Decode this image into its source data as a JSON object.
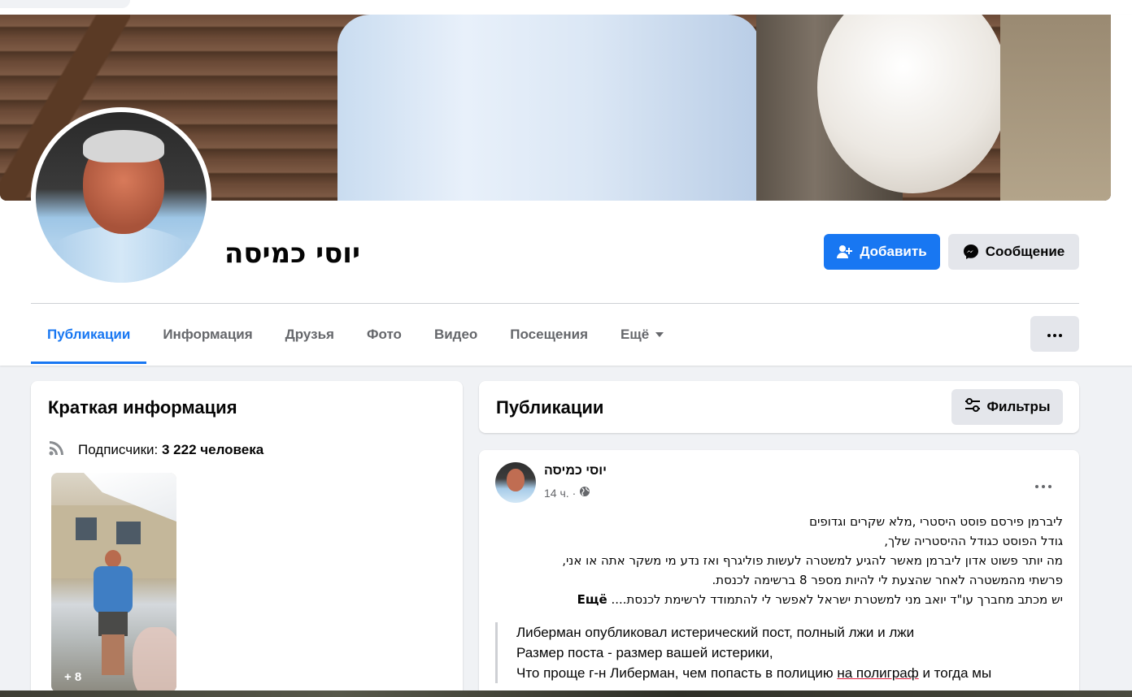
{
  "profile": {
    "name": "יוסי כמיסה",
    "add_label": "Добавить",
    "message_label": "Сообщение"
  },
  "tabs": [
    {
      "label": "Публикации",
      "active": true
    },
    {
      "label": "Информация"
    },
    {
      "label": "Друзья"
    },
    {
      "label": "Фото"
    },
    {
      "label": "Видео"
    },
    {
      "label": "Посещения"
    },
    {
      "label": "Ещё"
    }
  ],
  "intro": {
    "title": "Краткая информация",
    "followers_label": "Подписчики:",
    "followers_value": "3 222 человека",
    "photo_more": "+ 8"
  },
  "posts": {
    "title": "Публикации",
    "filters_label": "Фильтры"
  },
  "post": {
    "author": "יוסי כמיסה",
    "time": "14 ч.",
    "separator": "·",
    "lines": [
      "ליברמן פירסם פוסט היסטרי ,מלא שקרים וגדופים",
      "גודל הפוסט כגודל ההיסטריה שלך,",
      "מה יותר פשוט אדון ליברמן מאשר להגיע למשטרה לעשות  פוליגרף ואז נדע מי משקר אתה או אני,",
      "פרשתי מהמשטרה לאחר שהצעת לי להיות מספר 8 ברשימה לכנסת.",
      "יש מכתב מחברך  עו\"ד יואב מני למשטרת ישראל לאפשר לי להתמודד לרשימת לכנסת...."
    ],
    "see_more": "Ещё",
    "translation": [
      "Либерман опубликовал истерический пост, полный лжи и лжи",
      "Размер поста - размер вашей истерики,",
      "Что проще г-н Либерман, чем попасть в полицию",
      "на полиграф",
      "и тогда мы"
    ]
  },
  "colors": {
    "accent": "#1877f2",
    "background": "#f0f2f5",
    "button_gray": "#e4e6eb",
    "secondary_text": "#65676b"
  },
  "icons": {
    "add_friend": "person-plus-icon",
    "messenger": "messenger-icon",
    "more": "ellipsis-icon",
    "filters": "sliders-icon",
    "followers": "rss-icon",
    "privacy": "globe-icon"
  }
}
